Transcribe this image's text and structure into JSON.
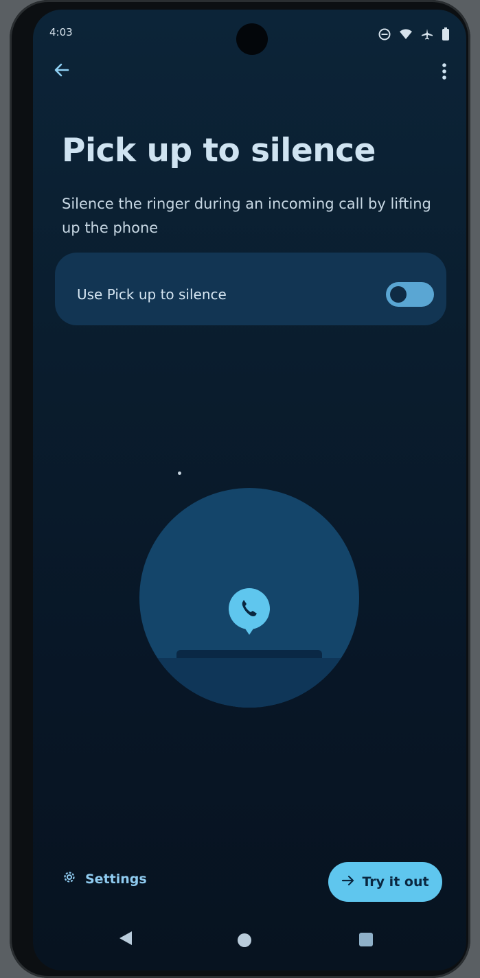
{
  "status_bar": {
    "time": "4:03",
    "icons": [
      "do-not-disturb-icon",
      "wifi-icon",
      "airplane-icon",
      "battery-icon"
    ]
  },
  "header": {
    "back_icon": "arrow-left-icon",
    "menu_icon": "more-vertical-icon"
  },
  "page": {
    "title": "Pick up to silence",
    "description": "Silence the ringer during an incoming call by lifting up the phone"
  },
  "toggle": {
    "label": "Use Pick up to silence",
    "state": "off"
  },
  "illustration": {
    "icon": "phone-call-bubble-icon"
  },
  "footer": {
    "settings_label": "Settings",
    "settings_icon": "gear-icon",
    "try_label": "Try it out",
    "try_icon": "arrow-right-icon"
  },
  "nav_bar": {
    "icons": [
      "nav-back-triangle-icon",
      "nav-home-circle-icon",
      "nav-recents-square-icon"
    ]
  },
  "colors": {
    "background": "#0a1d2e",
    "accent": "#5fc6ee",
    "card": "#123553",
    "title": "#cfe3f1"
  }
}
